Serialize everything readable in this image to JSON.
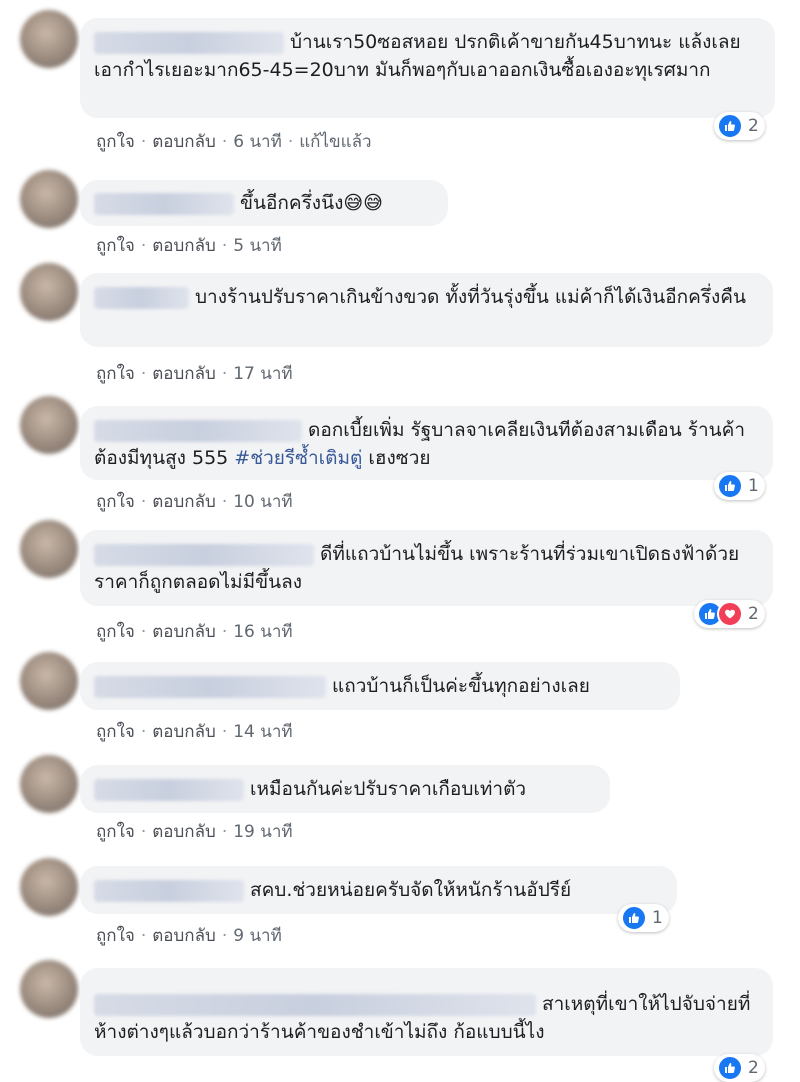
{
  "labels": {
    "like": "ถูกใจ",
    "reply": "ตอบกลับ",
    "edited": "แก้ไขแล้ว"
  },
  "comments": [
    {
      "text": "บ้านเรา50ซอสหอย ปรกติเค้าขายกัน45บาทนะ แล้งเลยเอากำไรเยอะมาก65-45=20บาท มันก็พอๆกับเอาออกเงินซื้อเองอะทุเรศมาก",
      "time": "6 นาที",
      "edited": true,
      "reactions": {
        "types": [
          "like"
        ],
        "count": "2"
      }
    },
    {
      "text": "ขึ้นอีกครึ่งนึง😅😅",
      "time": "5 นาที"
    },
    {
      "text": "บางร้านปรับราคาเกินข้างขวด ทั้งที่วันรุ่งขึ้น แม่ค้าก็ได้เงินอีกครึ่งคืน",
      "time": "17 นาที"
    },
    {
      "text_before": "ดอกเบี้ยเพิ่ม รัฐบาลจาเคลียเงินทีต้องสามเดือน ร้านค้าต้องมีทุนสูง 555 ",
      "hashtag": "#ช่วยรีซ้ำเติมตู่",
      "text_after": " เฮงซวย",
      "time": "10 นาที",
      "reactions": {
        "types": [
          "like"
        ],
        "count": "1"
      }
    },
    {
      "text": "ดีที่แถวบ้านไม่ขึ้น เพราะร้านที่ร่วมเขาเปิดธงฟ้าด้วย ราคาก็ถูกตลอดไม่มีขึ้นลง",
      "time": "16 นาที",
      "reactions": {
        "types": [
          "like",
          "love"
        ],
        "count": "2"
      }
    },
    {
      "text": "แถวบ้านก็เป็นค่ะขึ้นทุกอย่างเลย",
      "time": "14 นาที"
    },
    {
      "text": "เหมือนกันค่ะปรับราคาเกือบเท่าตัว",
      "time": "19 นาที"
    },
    {
      "text": "สคบ.ช่วยหน่อยครับจัดให้หนักร้านอัปรีย์",
      "time": "9 นาที",
      "reactions": {
        "types": [
          "like"
        ],
        "count": "1"
      }
    },
    {
      "text": "สาเหตุที่เขาให้ไปจับจ่ายที่ห้างต่างๆแล้วบอกว่าร้านค้าของชำเข้าไม่ถึง ก้อแบบนี้ไง",
      "reactions": {
        "types": [
          "like"
        ],
        "count": "2"
      }
    }
  ],
  "colors": {
    "like": "#1877f2",
    "love": "#f33e58",
    "bubble": "#f2f3f5",
    "hashtag": "#385898"
  }
}
